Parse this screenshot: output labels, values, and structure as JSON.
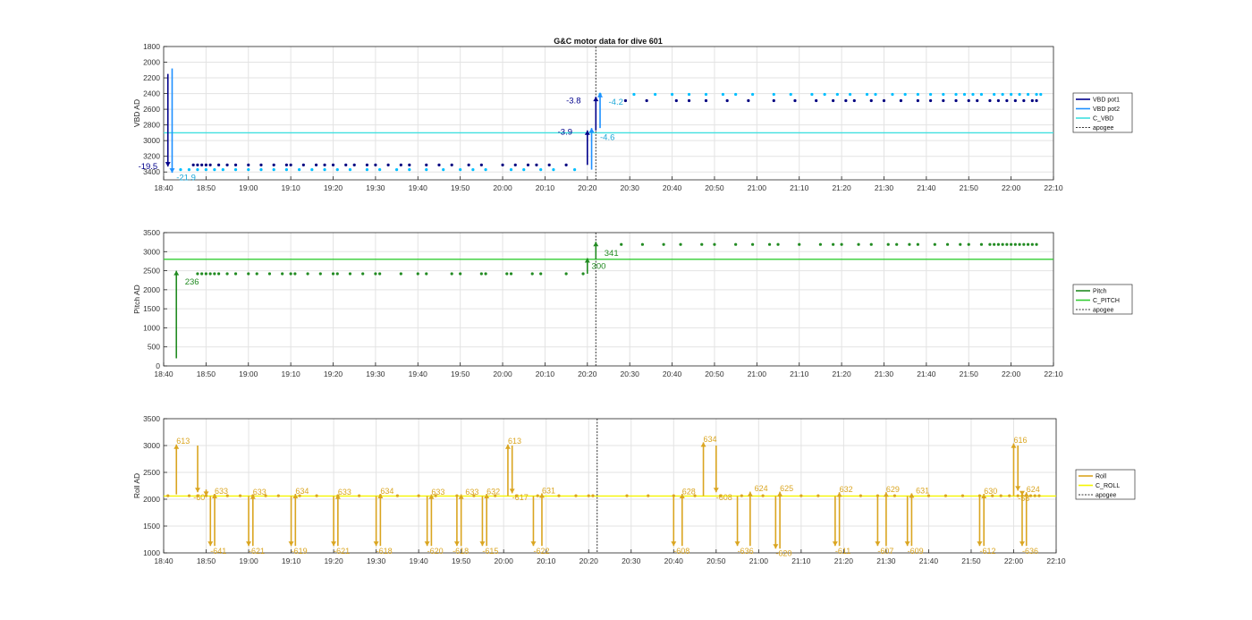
{
  "figure_title": "G&C motor data for dive 601",
  "colors": {
    "vbd_pot1": "#00008B",
    "vbd_pot2": "#1E90FF",
    "c_vbd": "#40E0E0",
    "vbd_dots1": "#000080",
    "vbd_dots2": "#00BFFF",
    "pitch": "#228B22",
    "c_pitch": "#32CD32",
    "roll": "#DAA520",
    "c_roll": "#F5F500",
    "apogee": "#333333",
    "grid": "#e3e3e3",
    "axis": "#262626"
  },
  "chart_data": [
    {
      "id": "vbd",
      "type": "scatter",
      "title": "G&C motor data for dive 601",
      "ylabel": "VBD AD",
      "xlabel": "",
      "x_unit": "minutes since 18:40",
      "xlim": [
        "18:40",
        "22:10"
      ],
      "xticks": [
        "18:40",
        "18:50",
        "19:00",
        "19:10",
        "19:20",
        "19:30",
        "19:40",
        "19:50",
        "20:00",
        "20:10",
        "20:20",
        "20:30",
        "20:40",
        "20:50",
        "21:00",
        "21:10",
        "21:20",
        "21:30",
        "21:40",
        "21:50",
        "22:00",
        "22:10"
      ],
      "ylim": [
        1800,
        3500
      ],
      "y_reversed": true,
      "yticks": [
        "1800",
        "2000",
        "2200",
        "2400",
        "2600",
        "2800",
        "3000",
        "3200",
        "3400"
      ],
      "grid": true,
      "legend_position": "right",
      "legend": [
        "VBD pot1",
        "VBD pot2",
        "C_VBD",
        "apogee"
      ],
      "c_vbd_value": 2900,
      "apogee_time": "20:22",
      "dots_pot1": {
        "y": 3310,
        "times": [
          "18:47",
          "18:48",
          "18:49",
          "18:50",
          "18:51",
          "18:53",
          "18:55",
          "18:57",
          "19:00",
          "19:03",
          "19:06",
          "19:09",
          "19:10",
          "19:13",
          "19:16",
          "19:18",
          "19:20",
          "19:23",
          "19:25",
          "19:28",
          "19:30",
          "19:33",
          "19:36",
          "19:38",
          "19:42",
          "19:45",
          "19:48",
          "19:52",
          "19:55",
          "20:00",
          "20:03",
          "20:06",
          "20:08",
          "20:11",
          "20:15"
        ],
        "times_after": [
          "20:29",
          "20:34",
          "20:41",
          "20:44",
          "20:48",
          "20:53",
          "20:58",
          "21:04",
          "21:09",
          "21:14",
          "21:18",
          "21:21",
          "21:23",
          "21:27",
          "21:30",
          "21:34",
          "21:38",
          "21:41",
          "21:44",
          "21:47",
          "21:50",
          "21:52",
          "21:55",
          "21:57",
          "21:59",
          "22:01",
          "22:03",
          "22:05",
          "22:06"
        ],
        "y_after": 2490
      },
      "dots_pot2": {
        "y": 3370,
        "times": [
          "18:44",
          "18:46",
          "18:48",
          "18:50",
          "18:52",
          "18:54",
          "18:57",
          "19:00",
          "19:03",
          "19:06",
          "19:09",
          "19:12",
          "19:15",
          "19:18",
          "19:21",
          "19:24",
          "19:28",
          "19:31",
          "19:35",
          "19:38",
          "19:42",
          "19:46",
          "19:50",
          "19:53",
          "19:56",
          "20:02",
          "20:05",
          "20:09",
          "20:12",
          "20:17"
        ],
        "times_after": [
          "20:23",
          "20:31",
          "20:36",
          "20:40",
          "20:44",
          "20:48",
          "20:52",
          "20:55",
          "20:59",
          "21:04",
          "21:08",
          "21:13",
          "21:16",
          "21:19",
          "21:22",
          "21:26",
          "21:28",
          "21:32",
          "21:35",
          "21:38",
          "21:41",
          "21:44",
          "21:47",
          "21:49",
          "21:51",
          "21:53",
          "21:56",
          "21:58",
          "22:00",
          "22:02",
          "22:04",
          "22:06",
          "22:07"
        ],
        "y_after": 2410
      },
      "arrows": [
        {
          "series": "pot1",
          "x": "18:41",
          "y_from": 2150,
          "y_to": 3330,
          "label": "-19.5",
          "label_x": "18:34",
          "label_y": 3330
        },
        {
          "series": "pot2",
          "x": "18:42",
          "y_from": 2080,
          "y_to": 3410,
          "label": "-21.9",
          "label_x": "18:43",
          "label_y": 3470
        },
        {
          "series": "pot1",
          "x": "20:20",
          "y_from": 3310,
          "y_to": 2870,
          "label": "-3.9",
          "label_x": "20:13",
          "label_y": 2890
        },
        {
          "series": "pot2",
          "x": "20:21",
          "y_from": 3370,
          "y_to": 2840,
          "label": "-4.6",
          "label_x": "20:23",
          "label_y": 2960
        },
        {
          "series": "pot1",
          "x": "20:22",
          "y_from": 2870,
          "y_to": 2440,
          "label": "-3.8",
          "label_x": "20:15",
          "label_y": 2490
        },
        {
          "series": "pot2",
          "x": "20:23",
          "y_from": 2840,
          "y_to": 2390,
          "label": "-4.2",
          "label_x": "20:25",
          "label_y": 2510
        }
      ]
    },
    {
      "id": "pitch",
      "type": "scatter",
      "ylabel": "Pitch AD",
      "xlabel": "",
      "x_unit": "minutes since 18:40",
      "xlim": [
        "18:40",
        "22:10"
      ],
      "xticks": [
        "18:40",
        "18:50",
        "19:00",
        "19:10",
        "19:20",
        "19:30",
        "19:40",
        "19:50",
        "20:00",
        "20:10",
        "20:20",
        "20:30",
        "20:40",
        "20:50",
        "21:00",
        "21:10",
        "21:20",
        "21:30",
        "21:40",
        "21:50",
        "22:00",
        "22:10"
      ],
      "ylim": [
        0,
        3500
      ],
      "yticks": [
        "0",
        "500",
        "1000",
        "1500",
        "2000",
        "2500",
        "3000",
        "3500"
      ],
      "grid": true,
      "legend_position": "right",
      "legend": [
        "Pitch",
        "C_PITCH",
        "apogee"
      ],
      "c_pitch_value": 2800,
      "apogee_time": "20:22",
      "dots": {
        "y": 2420,
        "times": [
          "18:48",
          "18:49",
          "18:50",
          "18:51",
          "18:52",
          "18:53",
          "18:55",
          "18:57",
          "19:00",
          "19:02",
          "19:05",
          "19:08",
          "19:10",
          "19:11",
          "19:14",
          "19:17",
          "19:20",
          "19:21",
          "19:24",
          "19:27",
          "19:30",
          "19:31",
          "19:36",
          "19:40",
          "19:42",
          "19:48",
          "19:50",
          "19:55",
          "19:56",
          "20:01",
          "20:02",
          "20:07",
          "20:09",
          "20:15",
          "20:19"
        ],
        "times_after": [
          "20:28",
          "20:33",
          "20:38",
          "20:42",
          "20:47",
          "20:50",
          "20:55",
          "20:59",
          "21:03",
          "21:05",
          "21:10",
          "21:15",
          "21:18",
          "21:20",
          "21:24",
          "21:27",
          "21:31",
          "21:33",
          "21:36",
          "21:38",
          "21:42",
          "21:45",
          "21:48",
          "21:50",
          "21:53",
          "21:55",
          "21:56",
          "21:57",
          "21:58",
          "21:59",
          "22:00",
          "22:01",
          "22:02",
          "22:03",
          "22:04",
          "22:05",
          "22:06"
        ],
        "y_after": 3190
      },
      "arrows": [
        {
          "x": "18:43",
          "y_from": 200,
          "y_to": 2500,
          "label": "236",
          "label_x": "18:45",
          "label_y": 2210
        },
        {
          "x": "20:20",
          "y_from": 2420,
          "y_to": 2830,
          "label": "300",
          "label_x": "20:21",
          "label_y": 2620
        },
        {
          "x": "20:22",
          "y_from": 2800,
          "y_to": 3260,
          "label": "341",
          "label_x": "20:24",
          "label_y": 2960
        }
      ]
    },
    {
      "id": "roll",
      "type": "scatter",
      "ylabel": "Roll AD",
      "xlabel": "",
      "x_unit": "minutes since 18:40",
      "xlim": [
        "18:40",
        "22:10"
      ],
      "xticks": [
        "18:40",
        "18:50",
        "19:00",
        "19:10",
        "19:20",
        "19:30",
        "19:40",
        "19:50",
        "20:00",
        "20:10",
        "20:20",
        "20:30",
        "20:40",
        "20:50",
        "21:00",
        "21:10",
        "21:20",
        "21:30",
        "21:40",
        "21:50",
        "22:00",
        "22:10"
      ],
      "ylim": [
        1000,
        3500
      ],
      "yticks": [
        "1000",
        "1500",
        "2000",
        "2500",
        "3000",
        "3500"
      ],
      "grid": true,
      "legend_position": "right",
      "legend": [
        "Roll",
        "C_ROLL",
        "apogee"
      ],
      "c_roll_value": 2060,
      "apogee_time": "20:22",
      "dots": {
        "y": 2065,
        "times": [
          "18:41",
          "18:46",
          "18:48",
          "18:50",
          "18:52",
          "18:55",
          "18:58",
          "19:01",
          "19:04",
          "19:07",
          "19:12",
          "19:16",
          "19:21",
          "19:26",
          "19:31",
          "19:35",
          "19:40",
          "19:44",
          "19:49",
          "19:53",
          "19:58",
          "20:03",
          "20:08",
          "20:13",
          "20:17",
          "20:20",
          "20:21",
          "20:29",
          "20:34",
          "20:40",
          "20:45",
          "20:51",
          "20:56",
          "21:01",
          "21:05",
          "21:10",
          "21:14",
          "21:19",
          "21:24",
          "21:28",
          "21:32",
          "21:36",
          "21:40",
          "21:44",
          "21:48",
          "21:52",
          "21:55",
          "21:57",
          "21:59",
          "22:01",
          "22:02",
          "22:04",
          "22:05",
          "22:06"
        ]
      },
      "arrows": [
        {
          "x": "18:43",
          "y_from": 2090,
          "y_to": 3020,
          "label": "613",
          "label_x": "18:43",
          "label_y": 3080
        },
        {
          "x": "18:48",
          "y_from": 3000,
          "y_to": 2130,
          "label": "",
          "label_x": "",
          "label_y": 0
        },
        {
          "x": "18:51",
          "y_from": 2060,
          "y_to": 1130,
          "label": "-641",
          "label_x": "18:51",
          "label_y": 1030
        },
        {
          "x": "18:52",
          "y_from": 1130,
          "y_to": 2100,
          "label": "633",
          "label_x": "18:52",
          "label_y": 2150
        },
        {
          "x": "18:50",
          "y_from": 2180,
          "y_to": 2060,
          "label": "-60",
          "label_x": "18:47",
          "label_y": 2030
        },
        {
          "x": "19:00",
          "y_from": 2060,
          "y_to": 1130,
          "label": "-621",
          "label_x": "19:00",
          "label_y": 1030
        },
        {
          "x": "19:01",
          "y_from": 1130,
          "y_to": 2090,
          "label": "633",
          "label_x": "19:01",
          "label_y": 2130
        },
        {
          "x": "19:10",
          "y_from": 2060,
          "y_to": 1130,
          "label": "-619",
          "label_x": "19:10",
          "label_y": 1030
        },
        {
          "x": "19:11",
          "y_from": 1130,
          "y_to": 2100,
          "label": "634",
          "label_x": "19:11",
          "label_y": 2150
        },
        {
          "x": "19:20",
          "y_from": 2060,
          "y_to": 1130,
          "label": "-621",
          "label_x": "19:20",
          "label_y": 1030
        },
        {
          "x": "19:21",
          "y_from": 1130,
          "y_to": 2090,
          "label": "633",
          "label_x": "19:21",
          "label_y": 2130
        },
        {
          "x": "19:30",
          "y_from": 2060,
          "y_to": 1130,
          "label": "-618",
          "label_x": "19:30",
          "label_y": 1030
        },
        {
          "x": "19:31",
          "y_from": 1130,
          "y_to": 2100,
          "label": "634",
          "label_x": "19:31",
          "label_y": 2150
        },
        {
          "x": "19:42",
          "y_from": 2060,
          "y_to": 1130,
          "label": "-620",
          "label_x": "19:42",
          "label_y": 1030
        },
        {
          "x": "19:43",
          "y_from": 1130,
          "y_to": 2090,
          "label": "633",
          "label_x": "19:43",
          "label_y": 2130
        },
        {
          "x": "19:49",
          "y_from": 2060,
          "y_to": 1130,
          "label": "-618",
          "label_x": "19:48",
          "label_y": 1030
        },
        {
          "x": "19:50",
          "y_from": 1130,
          "y_to": 2090,
          "label": "633",
          "label_x": "19:51",
          "label_y": 2130
        },
        {
          "x": "19:55",
          "y_from": 2060,
          "y_to": 1130,
          "label": "-615",
          "label_x": "19:55",
          "label_y": 1030
        },
        {
          "x": "19:56",
          "y_from": 1130,
          "y_to": 2100,
          "label": "632",
          "label_x": "19:56",
          "label_y": 2140
        },
        {
          "x": "20:01",
          "y_from": 2060,
          "y_to": 3020,
          "label": "613",
          "label_x": "20:01",
          "label_y": 3080
        },
        {
          "x": "20:02",
          "y_from": 3000,
          "y_to": 2110,
          "label": "-617",
          "label_x": "20:02",
          "label_y": 2030
        },
        {
          "x": "20:07",
          "y_from": 2060,
          "y_to": 1130,
          "label": "-622",
          "label_x": "20:07",
          "label_y": 1030
        },
        {
          "x": "20:09",
          "y_from": 1130,
          "y_to": 2110,
          "label": "631",
          "label_x": "20:09",
          "label_y": 2160
        },
        {
          "x": "20:40",
          "y_from": 2060,
          "y_to": 1130,
          "label": "-608",
          "label_x": "20:40",
          "label_y": 1030
        },
        {
          "x": "20:42",
          "y_from": 1130,
          "y_to": 2100,
          "label": "628",
          "label_x": "20:42",
          "label_y": 2140
        },
        {
          "x": "20:47",
          "y_from": 2060,
          "y_to": 3060,
          "label": "634",
          "label_x": "20:47",
          "label_y": 3120
        },
        {
          "x": "20:50",
          "y_from": 3000,
          "y_to": 2130,
          "label": "-608",
          "label_x": "20:50",
          "label_y": 2030
        },
        {
          "x": "20:55",
          "y_from": 2060,
          "y_to": 1130,
          "label": "-636",
          "label_x": "20:55",
          "label_y": 1030
        },
        {
          "x": "20:58",
          "y_from": 1130,
          "y_to": 2140,
          "label": "624",
          "label_x": "20:59",
          "label_y": 2200
        },
        {
          "x": "21:04",
          "y_from": 2060,
          "y_to": 1080,
          "label": "-620",
          "label_x": "21:04",
          "label_y": 990
        },
        {
          "x": "21:05",
          "y_from": 1080,
          "y_to": 2140,
          "label": "625",
          "label_x": "21:05",
          "label_y": 2200
        },
        {
          "x": "21:18",
          "y_from": 2060,
          "y_to": 1130,
          "label": "-611",
          "label_x": "21:18",
          "label_y": 1030
        },
        {
          "x": "21:19",
          "y_from": 1130,
          "y_to": 2130,
          "label": "632",
          "label_x": "21:19",
          "label_y": 2180
        },
        {
          "x": "21:28",
          "y_from": 2060,
          "y_to": 1130,
          "label": "-607",
          "label_x": "21:28",
          "label_y": 1030
        },
        {
          "x": "21:30",
          "y_from": 1130,
          "y_to": 2130,
          "label": "629",
          "label_x": "21:30",
          "label_y": 2180
        },
        {
          "x": "21:35",
          "y_from": 2060,
          "y_to": 1130,
          "label": "-609",
          "label_x": "21:35",
          "label_y": 1030
        },
        {
          "x": "21:36",
          "y_from": 1130,
          "y_to": 2110,
          "label": "631",
          "label_x": "21:37",
          "label_y": 2160
        },
        {
          "x": "21:52",
          "y_from": 2060,
          "y_to": 1130,
          "label": "-612",
          "label_x": "21:52",
          "label_y": 1030
        },
        {
          "x": "21:53",
          "y_from": 1130,
          "y_to": 2100,
          "label": "630",
          "label_x": "21:53",
          "label_y": 2150
        },
        {
          "x": "22:00",
          "y_from": 2060,
          "y_to": 3040,
          "label": "616",
          "label_x": "22:00",
          "label_y": 3100
        },
        {
          "x": "22:01",
          "y_from": 3000,
          "y_to": 2160,
          "label": "",
          "label_x": "",
          "label_y": 0
        },
        {
          "x": "22:02",
          "y_from": 2060,
          "y_to": 1130,
          "label": "-636",
          "label_x": "22:02",
          "label_y": 1030
        },
        {
          "x": "22:03",
          "y_from": 1130,
          "y_to": 2130,
          "label": "624",
          "label_x": "22:03",
          "label_y": 2180
        },
        {
          "x": "22:02",
          "y_from": 2100,
          "y_to": 2070,
          "label": "-58",
          "label_x": "22:01",
          "label_y": 2020
        }
      ]
    }
  ]
}
